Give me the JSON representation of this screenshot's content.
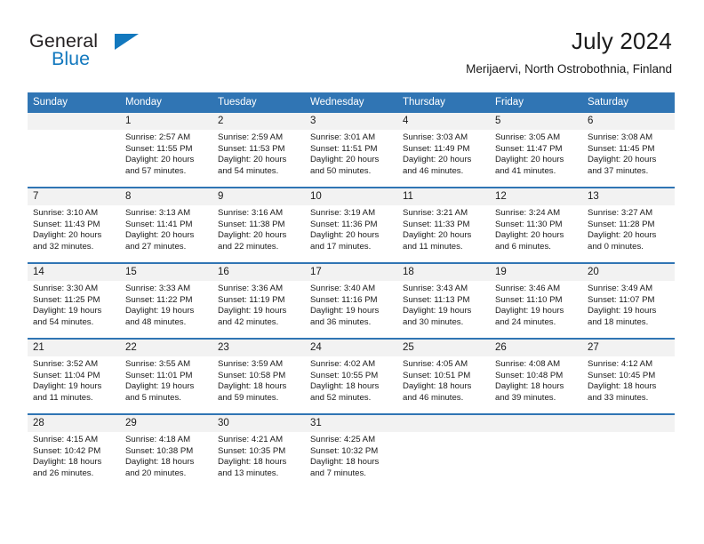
{
  "brand": {
    "word1": "General",
    "word2": "Blue",
    "accent_color": "#1278be"
  },
  "header": {
    "title": "July 2024",
    "subtitle": "Merijaervi, North Ostrobothnia, Finland",
    "header_bg_color": "#3075b4",
    "daynum_bg_color": "#f2f2f2"
  },
  "weekdays": [
    "Sunday",
    "Monday",
    "Tuesday",
    "Wednesday",
    "Thursday",
    "Friday",
    "Saturday"
  ],
  "weeks": [
    [
      {
        "day": "",
        "lines": []
      },
      {
        "day": "1",
        "lines": [
          "Sunrise: 2:57 AM",
          "Sunset: 11:55 PM",
          "Daylight: 20 hours",
          "and 57 minutes."
        ]
      },
      {
        "day": "2",
        "lines": [
          "Sunrise: 2:59 AM",
          "Sunset: 11:53 PM",
          "Daylight: 20 hours",
          "and 54 minutes."
        ]
      },
      {
        "day": "3",
        "lines": [
          "Sunrise: 3:01 AM",
          "Sunset: 11:51 PM",
          "Daylight: 20 hours",
          "and 50 minutes."
        ]
      },
      {
        "day": "4",
        "lines": [
          "Sunrise: 3:03 AM",
          "Sunset: 11:49 PM",
          "Daylight: 20 hours",
          "and 46 minutes."
        ]
      },
      {
        "day": "5",
        "lines": [
          "Sunrise: 3:05 AM",
          "Sunset: 11:47 PM",
          "Daylight: 20 hours",
          "and 41 minutes."
        ]
      },
      {
        "day": "6",
        "lines": [
          "Sunrise: 3:08 AM",
          "Sunset: 11:45 PM",
          "Daylight: 20 hours",
          "and 37 minutes."
        ]
      }
    ],
    [
      {
        "day": "7",
        "lines": [
          "Sunrise: 3:10 AM",
          "Sunset: 11:43 PM",
          "Daylight: 20 hours",
          "and 32 minutes."
        ]
      },
      {
        "day": "8",
        "lines": [
          "Sunrise: 3:13 AM",
          "Sunset: 11:41 PM",
          "Daylight: 20 hours",
          "and 27 minutes."
        ]
      },
      {
        "day": "9",
        "lines": [
          "Sunrise: 3:16 AM",
          "Sunset: 11:38 PM",
          "Daylight: 20 hours",
          "and 22 minutes."
        ]
      },
      {
        "day": "10",
        "lines": [
          "Sunrise: 3:19 AM",
          "Sunset: 11:36 PM",
          "Daylight: 20 hours",
          "and 17 minutes."
        ]
      },
      {
        "day": "11",
        "lines": [
          "Sunrise: 3:21 AM",
          "Sunset: 11:33 PM",
          "Daylight: 20 hours",
          "and 11 minutes."
        ]
      },
      {
        "day": "12",
        "lines": [
          "Sunrise: 3:24 AM",
          "Sunset: 11:30 PM",
          "Daylight: 20 hours",
          "and 6 minutes."
        ]
      },
      {
        "day": "13",
        "lines": [
          "Sunrise: 3:27 AM",
          "Sunset: 11:28 PM",
          "Daylight: 20 hours",
          "and 0 minutes."
        ]
      }
    ],
    [
      {
        "day": "14",
        "lines": [
          "Sunrise: 3:30 AM",
          "Sunset: 11:25 PM",
          "Daylight: 19 hours",
          "and 54 minutes."
        ]
      },
      {
        "day": "15",
        "lines": [
          "Sunrise: 3:33 AM",
          "Sunset: 11:22 PM",
          "Daylight: 19 hours",
          "and 48 minutes."
        ]
      },
      {
        "day": "16",
        "lines": [
          "Sunrise: 3:36 AM",
          "Sunset: 11:19 PM",
          "Daylight: 19 hours",
          "and 42 minutes."
        ]
      },
      {
        "day": "17",
        "lines": [
          "Sunrise: 3:40 AM",
          "Sunset: 11:16 PM",
          "Daylight: 19 hours",
          "and 36 minutes."
        ]
      },
      {
        "day": "18",
        "lines": [
          "Sunrise: 3:43 AM",
          "Sunset: 11:13 PM",
          "Daylight: 19 hours",
          "and 30 minutes."
        ]
      },
      {
        "day": "19",
        "lines": [
          "Sunrise: 3:46 AM",
          "Sunset: 11:10 PM",
          "Daylight: 19 hours",
          "and 24 minutes."
        ]
      },
      {
        "day": "20",
        "lines": [
          "Sunrise: 3:49 AM",
          "Sunset: 11:07 PM",
          "Daylight: 19 hours",
          "and 18 minutes."
        ]
      }
    ],
    [
      {
        "day": "21",
        "lines": [
          "Sunrise: 3:52 AM",
          "Sunset: 11:04 PM",
          "Daylight: 19 hours",
          "and 11 minutes."
        ]
      },
      {
        "day": "22",
        "lines": [
          "Sunrise: 3:55 AM",
          "Sunset: 11:01 PM",
          "Daylight: 19 hours",
          "and 5 minutes."
        ]
      },
      {
        "day": "23",
        "lines": [
          "Sunrise: 3:59 AM",
          "Sunset: 10:58 PM",
          "Daylight: 18 hours",
          "and 59 minutes."
        ]
      },
      {
        "day": "24",
        "lines": [
          "Sunrise: 4:02 AM",
          "Sunset: 10:55 PM",
          "Daylight: 18 hours",
          "and 52 minutes."
        ]
      },
      {
        "day": "25",
        "lines": [
          "Sunrise: 4:05 AM",
          "Sunset: 10:51 PM",
          "Daylight: 18 hours",
          "and 46 minutes."
        ]
      },
      {
        "day": "26",
        "lines": [
          "Sunrise: 4:08 AM",
          "Sunset: 10:48 PM",
          "Daylight: 18 hours",
          "and 39 minutes."
        ]
      },
      {
        "day": "27",
        "lines": [
          "Sunrise: 4:12 AM",
          "Sunset: 10:45 PM",
          "Daylight: 18 hours",
          "and 33 minutes."
        ]
      }
    ],
    [
      {
        "day": "28",
        "lines": [
          "Sunrise: 4:15 AM",
          "Sunset: 10:42 PM",
          "Daylight: 18 hours",
          "and 26 minutes."
        ]
      },
      {
        "day": "29",
        "lines": [
          "Sunrise: 4:18 AM",
          "Sunset: 10:38 PM",
          "Daylight: 18 hours",
          "and 20 minutes."
        ]
      },
      {
        "day": "30",
        "lines": [
          "Sunrise: 4:21 AM",
          "Sunset: 10:35 PM",
          "Daylight: 18 hours",
          "and 13 minutes."
        ]
      },
      {
        "day": "31",
        "lines": [
          "Sunrise: 4:25 AM",
          "Sunset: 10:32 PM",
          "Daylight: 18 hours",
          "and 7 minutes."
        ]
      },
      {
        "day": "",
        "lines": []
      },
      {
        "day": "",
        "lines": []
      },
      {
        "day": "",
        "lines": []
      }
    ]
  ]
}
